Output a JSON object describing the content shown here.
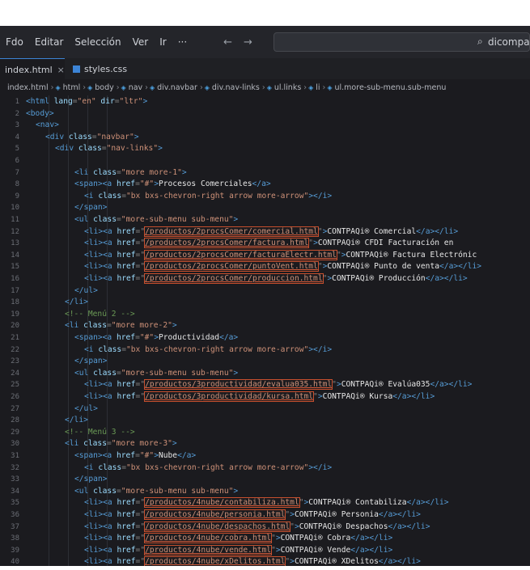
{
  "menu": {
    "items": [
      "Fdo",
      "Editar",
      "Selección",
      "Ver",
      "Ir",
      "···"
    ],
    "back_arrow": "←",
    "forward_arrow": "→"
  },
  "search": {
    "icon": "search-icon",
    "text": "dicompa"
  },
  "tabs": [
    {
      "label": "index.html",
      "close": "×"
    },
    {
      "label": "styles.css"
    }
  ],
  "breadcrumb": [
    "index.html",
    "html",
    "body",
    "nav",
    "div.navbar",
    "div.nav-links",
    "ul.links",
    "li",
    "ul.more-sub-menu.sub-menu"
  ],
  "code_lines": [
    {
      "n": "1",
      "indent": 0,
      "parts": [
        [
          "tag",
          "<html "
        ],
        [
          "attr",
          "lang"
        ],
        [
          "punct",
          "="
        ],
        [
          "str",
          "\"en\""
        ],
        [
          "attr",
          " dir"
        ],
        [
          "punct",
          "="
        ],
        [
          "str",
          "\"ltr\""
        ],
        [
          "tag",
          ">"
        ]
      ]
    },
    {
      "n": "2",
      "indent": 0,
      "parts": [
        [
          "tag",
          "<body>"
        ]
      ]
    },
    {
      "n": "3",
      "indent": 1,
      "parts": [
        [
          "tag",
          "<nav>"
        ]
      ]
    },
    {
      "n": "4",
      "indent": 2,
      "parts": [
        [
          "tag",
          "<div "
        ],
        [
          "attr",
          "class"
        ],
        [
          "punct",
          "="
        ],
        [
          "str",
          "\"navbar\""
        ],
        [
          "tag",
          ">"
        ]
      ]
    },
    {
      "n": "5",
      "indent": 3,
      "parts": [
        [
          "tag",
          "<div "
        ],
        [
          "attr",
          "class"
        ],
        [
          "punct",
          "="
        ],
        [
          "str",
          "\"nav-links\""
        ],
        [
          "tag",
          ">"
        ]
      ]
    },
    {
      "n": "6",
      "indent": 4,
      "parts": [
        [
          "punct",
          ""
        ]
      ]
    },
    {
      "n": "7",
      "indent": 5,
      "parts": [
        [
          "tag",
          "<li "
        ],
        [
          "attr",
          "class"
        ],
        [
          "punct",
          "="
        ],
        [
          "str",
          "\"more more-1\""
        ],
        [
          "tag",
          ">"
        ]
      ]
    },
    {
      "n": "8",
      "indent": 5,
      "parts": [
        [
          "tag",
          "<span><a "
        ],
        [
          "attr",
          "href"
        ],
        [
          "punct",
          "="
        ],
        [
          "str",
          "\"#\""
        ],
        [
          "tag",
          ">"
        ],
        [
          "txt",
          "Procesos Comerciales"
        ],
        [
          "tag",
          "</a>"
        ]
      ]
    },
    {
      "n": "9",
      "indent": 6,
      "parts": [
        [
          "tag",
          "<i "
        ],
        [
          "attr",
          "class"
        ],
        [
          "punct",
          "="
        ],
        [
          "str",
          "\"bx bxs-chevron-right arrow more-arrow\""
        ],
        [
          "tag",
          "></i>"
        ]
      ]
    },
    {
      "n": "10",
      "indent": 5,
      "parts": [
        [
          "tag",
          "</span>"
        ]
      ]
    },
    {
      "n": "11",
      "indent": 5,
      "parts": [
        [
          "tag",
          "<ul "
        ],
        [
          "attr",
          "class"
        ],
        [
          "punct",
          "="
        ],
        [
          "str",
          "\"more-sub-menu sub-menu\""
        ],
        [
          "tag",
          ">"
        ]
      ]
    },
    {
      "n": "12",
      "indent": 6,
      "parts": [
        [
          "tag",
          "<li><a "
        ],
        [
          "attr",
          "href"
        ],
        [
          "punct",
          "="
        ],
        [
          "punct",
          "\""
        ],
        [
          "link",
          "/productos/2procsComer/comercial.html"
        ],
        [
          "punct",
          "\""
        ],
        [
          "tag",
          ">"
        ],
        [
          "txt",
          "CONTPAQi® Comercial"
        ],
        [
          "tag",
          "</a></li>"
        ]
      ]
    },
    {
      "n": "13",
      "indent": 6,
      "parts": [
        [
          "tag",
          "<li><a "
        ],
        [
          "attr",
          "href"
        ],
        [
          "punct",
          "="
        ],
        [
          "punct",
          "\""
        ],
        [
          "link",
          "/productos/2procsComer/factura.html"
        ],
        [
          "punct",
          "\""
        ],
        [
          "tag",
          ">"
        ],
        [
          "txt",
          "CONTPAQi® CFDI Facturación en"
        ]
      ]
    },
    {
      "n": "14",
      "indent": 6,
      "parts": [
        [
          "tag",
          "<li><a "
        ],
        [
          "attr",
          "href"
        ],
        [
          "punct",
          "="
        ],
        [
          "punct",
          "\""
        ],
        [
          "link",
          "/productos/2procsComer/facturaElectr.html"
        ],
        [
          "punct",
          "\""
        ],
        [
          "tag",
          ">"
        ],
        [
          "txt",
          "CONTPAQi® Factura Electrónic"
        ]
      ]
    },
    {
      "n": "15",
      "indent": 6,
      "parts": [
        [
          "tag",
          "<li><a "
        ],
        [
          "attr",
          "href"
        ],
        [
          "punct",
          "="
        ],
        [
          "punct",
          "\""
        ],
        [
          "link",
          "/productos/2procsComer/puntoVent.html"
        ],
        [
          "punct",
          "\""
        ],
        [
          "tag",
          ">"
        ],
        [
          "txt",
          "CONTPAQi® Punto de venta"
        ],
        [
          "tag",
          "</a></li>"
        ]
      ]
    },
    {
      "n": "16",
      "indent": 6,
      "parts": [
        [
          "tag",
          "<li><a "
        ],
        [
          "attr",
          "href"
        ],
        [
          "punct",
          "="
        ],
        [
          "punct",
          "\""
        ],
        [
          "link",
          "/productos/2procsComer/produccion.html"
        ],
        [
          "punct",
          "\""
        ],
        [
          "tag",
          ">"
        ],
        [
          "txt",
          "CONTPAQi® Producción"
        ],
        [
          "tag",
          "</a></li>"
        ]
      ]
    },
    {
      "n": "17",
      "indent": 5,
      "parts": [
        [
          "tag",
          "</ul>"
        ]
      ]
    },
    {
      "n": "18",
      "indent": 4,
      "parts": [
        [
          "tag",
          "</li>"
        ]
      ]
    },
    {
      "n": "19",
      "indent": 4,
      "parts": [
        [
          "com",
          "<!-- Menú 2 -->"
        ]
      ]
    },
    {
      "n": "20",
      "indent": 4,
      "parts": [
        [
          "tag",
          "<li "
        ],
        [
          "attr",
          "class"
        ],
        [
          "punct",
          "="
        ],
        [
          "str",
          "\"more more-2\""
        ],
        [
          "tag",
          ">"
        ]
      ]
    },
    {
      "n": "21",
      "indent": 5,
      "parts": [
        [
          "tag",
          "<span><a "
        ],
        [
          "attr",
          "href"
        ],
        [
          "punct",
          "="
        ],
        [
          "str",
          "\"#\""
        ],
        [
          "tag",
          ">"
        ],
        [
          "txt",
          "Productividad"
        ],
        [
          "tag",
          "</a>"
        ]
      ]
    },
    {
      "n": "22",
      "indent": 6,
      "parts": [
        [
          "tag",
          "<i "
        ],
        [
          "attr",
          "class"
        ],
        [
          "punct",
          "="
        ],
        [
          "str",
          "\"bx bxs-chevron-right arrow more-arrow\""
        ],
        [
          "tag",
          "></i>"
        ]
      ]
    },
    {
      "n": "23",
      "indent": 5,
      "parts": [
        [
          "tag",
          "</span>"
        ]
      ]
    },
    {
      "n": "24",
      "indent": 5,
      "parts": [
        [
          "tag",
          "<ul "
        ],
        [
          "attr",
          "class"
        ],
        [
          "punct",
          "="
        ],
        [
          "str",
          "\"more-sub-menu sub-menu\""
        ],
        [
          "tag",
          ">"
        ]
      ]
    },
    {
      "n": "25",
      "indent": 6,
      "parts": [
        [
          "tag",
          "<li><a "
        ],
        [
          "attr",
          "href"
        ],
        [
          "punct",
          "="
        ],
        [
          "punct",
          "\""
        ],
        [
          "link",
          "/productos/3productividad/evalua035.html"
        ],
        [
          "punct",
          "\""
        ],
        [
          "tag",
          ">"
        ],
        [
          "txt",
          "CONTPAQi® Evalúa035"
        ],
        [
          "tag",
          "</a></li>"
        ]
      ]
    },
    {
      "n": "26",
      "indent": 6,
      "parts": [
        [
          "tag",
          "<li><a "
        ],
        [
          "attr",
          "href"
        ],
        [
          "punct",
          "="
        ],
        [
          "punct",
          "\""
        ],
        [
          "link",
          "/productos/3productividad/kursa.html"
        ],
        [
          "punct",
          "\""
        ],
        [
          "tag",
          ">"
        ],
        [
          "txt",
          "CONTPAQi® Kursa"
        ],
        [
          "tag",
          "</a></li>"
        ]
      ]
    },
    {
      "n": "27",
      "indent": 5,
      "parts": [
        [
          "tag",
          "</ul>"
        ]
      ]
    },
    {
      "n": "28",
      "indent": 4,
      "parts": [
        [
          "tag",
          "</li>"
        ]
      ]
    },
    {
      "n": "29",
      "indent": 4,
      "parts": [
        [
          "com",
          "<!-- Menú 3 -->"
        ]
      ]
    },
    {
      "n": "30",
      "indent": 4,
      "parts": [
        [
          "tag",
          "<li "
        ],
        [
          "attr",
          "class"
        ],
        [
          "punct",
          "="
        ],
        [
          "str",
          "\"more more-3\""
        ],
        [
          "tag",
          ">"
        ]
      ]
    },
    {
      "n": "31",
      "indent": 5,
      "parts": [
        [
          "tag",
          "<span><a "
        ],
        [
          "attr",
          "href"
        ],
        [
          "punct",
          "="
        ],
        [
          "str",
          "\"#\""
        ],
        [
          "tag",
          ">"
        ],
        [
          "txt",
          "Nube"
        ],
        [
          "tag",
          "</a>"
        ]
      ]
    },
    {
      "n": "32",
      "indent": 6,
      "parts": [
        [
          "tag",
          "<i "
        ],
        [
          "attr",
          "class"
        ],
        [
          "punct",
          "="
        ],
        [
          "str",
          "\"bx bxs-chevron-right arrow more-arrow\""
        ],
        [
          "tag",
          "></i>"
        ]
      ]
    },
    {
      "n": "33",
      "indent": 5,
      "parts": [
        [
          "tag",
          "</span>"
        ]
      ]
    },
    {
      "n": "34",
      "indent": 5,
      "parts": [
        [
          "tag",
          "<ul "
        ],
        [
          "attr",
          "class"
        ],
        [
          "punct",
          "="
        ],
        [
          "str",
          "\"more-sub-menu sub-menu\""
        ],
        [
          "tag",
          ">"
        ]
      ]
    },
    {
      "n": "35",
      "indent": 6,
      "parts": [
        [
          "tag",
          "<li><a "
        ],
        [
          "attr",
          "href"
        ],
        [
          "punct",
          "="
        ],
        [
          "punct",
          "\""
        ],
        [
          "link",
          "/productos/4nube/contabiliza.html"
        ],
        [
          "punct",
          "\""
        ],
        [
          "tag",
          ">"
        ],
        [
          "txt",
          "CONTPAQi® Contabiliza"
        ],
        [
          "tag",
          "</a></li>"
        ]
      ]
    },
    {
      "n": "36",
      "indent": 6,
      "parts": [
        [
          "tag",
          "<li><a "
        ],
        [
          "attr",
          "href"
        ],
        [
          "punct",
          "="
        ],
        [
          "punct",
          "\""
        ],
        [
          "link",
          "/productos/4nube/personia.html"
        ],
        [
          "punct",
          "\""
        ],
        [
          "tag",
          ">"
        ],
        [
          "txt",
          "CONTPAQi® Personia"
        ],
        [
          "tag",
          "</a></li>"
        ]
      ]
    },
    {
      "n": "37",
      "indent": 6,
      "parts": [
        [
          "tag",
          "<li><a "
        ],
        [
          "attr",
          "href"
        ],
        [
          "punct",
          "="
        ],
        [
          "punct",
          "\""
        ],
        [
          "link",
          "/productos/4nube/despachos.html"
        ],
        [
          "punct",
          "\""
        ],
        [
          "tag",
          ">"
        ],
        [
          "txt",
          "CONTPAQi® Despachos"
        ],
        [
          "tag",
          "</a></li>"
        ]
      ]
    },
    {
      "n": "38",
      "indent": 6,
      "parts": [
        [
          "tag",
          "<li><a "
        ],
        [
          "attr",
          "href"
        ],
        [
          "punct",
          "="
        ],
        [
          "punct",
          "\""
        ],
        [
          "link",
          "/productos/4nube/cobra.html"
        ],
        [
          "punct",
          "\""
        ],
        [
          "tag",
          ">"
        ],
        [
          "txt",
          "CONTPAQi® Cobra"
        ],
        [
          "tag",
          "</a></li>"
        ]
      ]
    },
    {
      "n": "39",
      "indent": 6,
      "parts": [
        [
          "tag",
          "<li><a "
        ],
        [
          "attr",
          "href"
        ],
        [
          "punct",
          "="
        ],
        [
          "punct",
          "\""
        ],
        [
          "link",
          "/productos/4nube/vende.html"
        ],
        [
          "punct",
          "\""
        ],
        [
          "tag",
          ">"
        ],
        [
          "txt",
          "CONTPAQi® Vende"
        ],
        [
          "tag",
          "</a></li>"
        ]
      ]
    },
    {
      "n": "40",
      "indent": 6,
      "parts": [
        [
          "tag",
          "<li><a "
        ],
        [
          "attr",
          "href"
        ],
        [
          "punct",
          "="
        ],
        [
          "punct",
          "\""
        ],
        [
          "link",
          "/productos/4nube/xDelitos.html"
        ],
        [
          "punct",
          "\""
        ],
        [
          "tag",
          ">"
        ],
        [
          "txt",
          "CONTPAQi® XDelitos"
        ],
        [
          "tag",
          "</a></li>"
        ]
      ]
    }
  ]
}
